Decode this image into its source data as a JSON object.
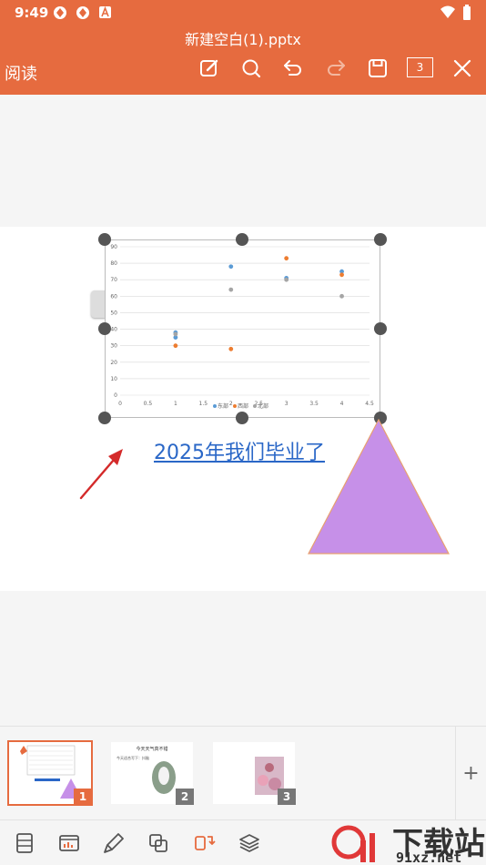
{
  "status_bar": {
    "time": "9:49"
  },
  "header": {
    "title": "新建空白(1).pptx",
    "mode_label": "阅读",
    "page_count": "3"
  },
  "slide": {
    "link_text": "2025年我们毕业了",
    "triangle_color": "#c690e8"
  },
  "chart_data": {
    "type": "scatter",
    "x_ticks": [
      "0",
      "0.5",
      "1",
      "1.5",
      "2",
      "2.5",
      "3",
      "3.5",
      "4",
      "4.5"
    ],
    "y_ticks": [
      "0",
      "10",
      "20",
      "30",
      "40",
      "50",
      "60",
      "70",
      "80",
      "90"
    ],
    "xlim": [
      0,
      4.5
    ],
    "ylim": [
      0,
      90
    ],
    "grid": true,
    "legend_position": "bottom",
    "series": [
      {
        "name": "东部",
        "color": "#5b9bd5",
        "points": [
          [
            1,
            38
          ],
          [
            1,
            35
          ],
          [
            2,
            78
          ],
          [
            3,
            71
          ],
          [
            4,
            75
          ]
        ]
      },
      {
        "name": "西部",
        "color": "#ed7d31",
        "points": [
          [
            1,
            30
          ],
          [
            2,
            28
          ],
          [
            3,
            83
          ],
          [
            4,
            73
          ]
        ]
      },
      {
        "name": "北部",
        "color": "#a5a5a5",
        "points": [
          [
            1,
            37
          ],
          [
            2,
            64
          ],
          [
            3,
            70
          ],
          [
            4,
            60
          ]
        ]
      }
    ]
  },
  "thumbnails": [
    {
      "number": "1"
    },
    {
      "number": "2",
      "title": "今天天气真不错",
      "bullet": "今天适合写下：抖脑"
    },
    {
      "number": "3"
    }
  ],
  "thumbnail_add_label": "+",
  "watermark": {
    "text": "下载站",
    "url": "91xz.net"
  },
  "colors": {
    "accent": "#e66b3f",
    "link": "#2a67c7"
  }
}
